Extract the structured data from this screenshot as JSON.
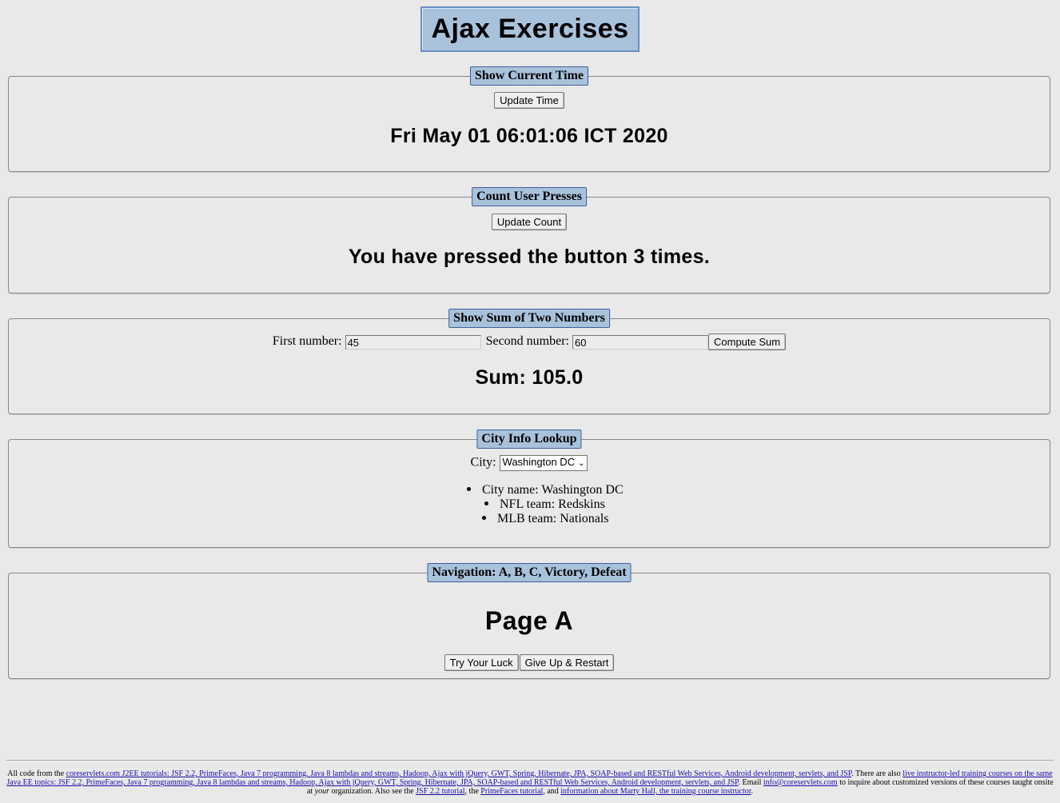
{
  "title": "Ajax Exercises",
  "time_panel": {
    "legend": "Show Current Time",
    "button": "Update Time",
    "result": "Fri May 01 06:01:06 ICT 2020"
  },
  "count_panel": {
    "legend": "Count User Presses",
    "button": "Update Count",
    "result": "You have pressed the button 3 times."
  },
  "sum_panel": {
    "legend": "Show Sum of Two Numbers",
    "first_label": "First number:",
    "first_value": "45",
    "second_label": "Second number:",
    "second_value": "60",
    "button": "Compute Sum",
    "result": "Sum: 105.0"
  },
  "city_panel": {
    "legend": "City Info Lookup",
    "city_label": "City:",
    "selected_city": "Washington DC",
    "items": [
      "City name: Washington DC",
      "NFL team: Redskins",
      "MLB team: Nationals"
    ]
  },
  "nav_panel": {
    "legend": "Navigation: A, B, C, Victory, Defeat",
    "heading": "Page A",
    "buttons": [
      "Try Your Luck",
      "Give Up & Restart"
    ]
  },
  "footer": {
    "t1": "All code from the ",
    "l1": "coreservlets.com J2EE tutorials: JSF 2.2, PrimeFaces, Java 7 programming, Java 8 lambdas and streams, Hadoop, Ajax with jQuery, GWT, Spring, Hibernate, JPA, SOAP-based and RESTful Web Services, Android development, servlets, and JSP",
    "t2": ". There are also ",
    "l2": "live instructor-led training courses on the same Java EE topics: JSF 2.2, PrimeFaces, Java 7 programming, Java 8 lambdas and streams, Hadoop, Ajax with jQuery, GWT, Spring, Hibernate, JPA, SOAP-based and RESTful Web Services, Android development, servlets, and JSP",
    "t3": ". Email ",
    "l3": "info@coreservlets.com",
    "t4": " to inquire about customized versions of these courses taught onsite at ",
    "t4i": "your",
    "t5": " organization. Also see the ",
    "l4": "JSF 2.2 tutorial",
    "t6": ", the ",
    "l5": "PrimeFaces tutorial",
    "t7": ", and ",
    "l6": "information about Marty Hall, the training course instructor",
    "t8": "."
  }
}
